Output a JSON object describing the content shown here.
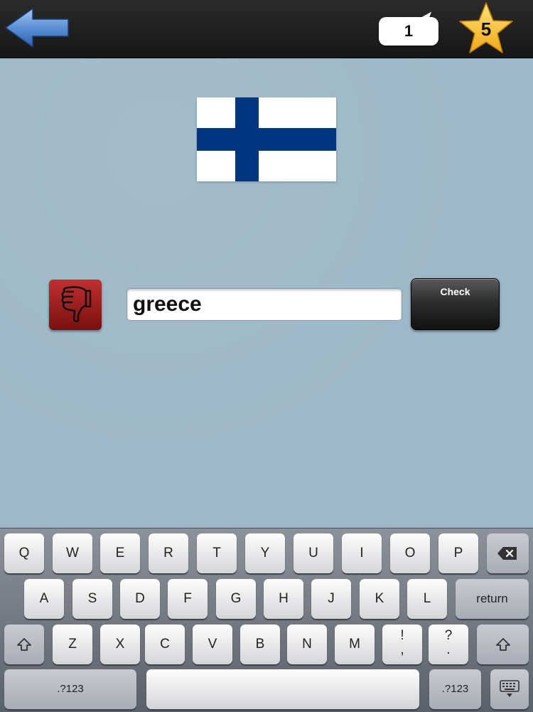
{
  "header": {
    "back_icon": "back-arrow-icon",
    "question_counter": "1",
    "stars": "5"
  },
  "quiz": {
    "flag": "finland-flag",
    "answer_value": "greece",
    "dislike_icon": "thumbs-down-icon",
    "check_label": "Check"
  },
  "keyboard": {
    "row1": [
      "Q",
      "W",
      "E",
      "R",
      "T",
      "Y",
      "U",
      "I",
      "O",
      "P"
    ],
    "row2": [
      "A",
      "S",
      "D",
      "F",
      "G",
      "H",
      "J",
      "K",
      "L"
    ],
    "row3": [
      "Z",
      "X",
      "C",
      "V",
      "B",
      "N",
      "M"
    ],
    "return_label": "return",
    "numbers_label": ".?123",
    "punct1_top": "!",
    "punct1_bottom": ",",
    "punct2_top": "?",
    "punct2_bottom": ".",
    "colors": {
      "accent_blue": "#5b8fd6",
      "flag_blue": "#003580",
      "dislike_red": "#a01b1b"
    }
  }
}
